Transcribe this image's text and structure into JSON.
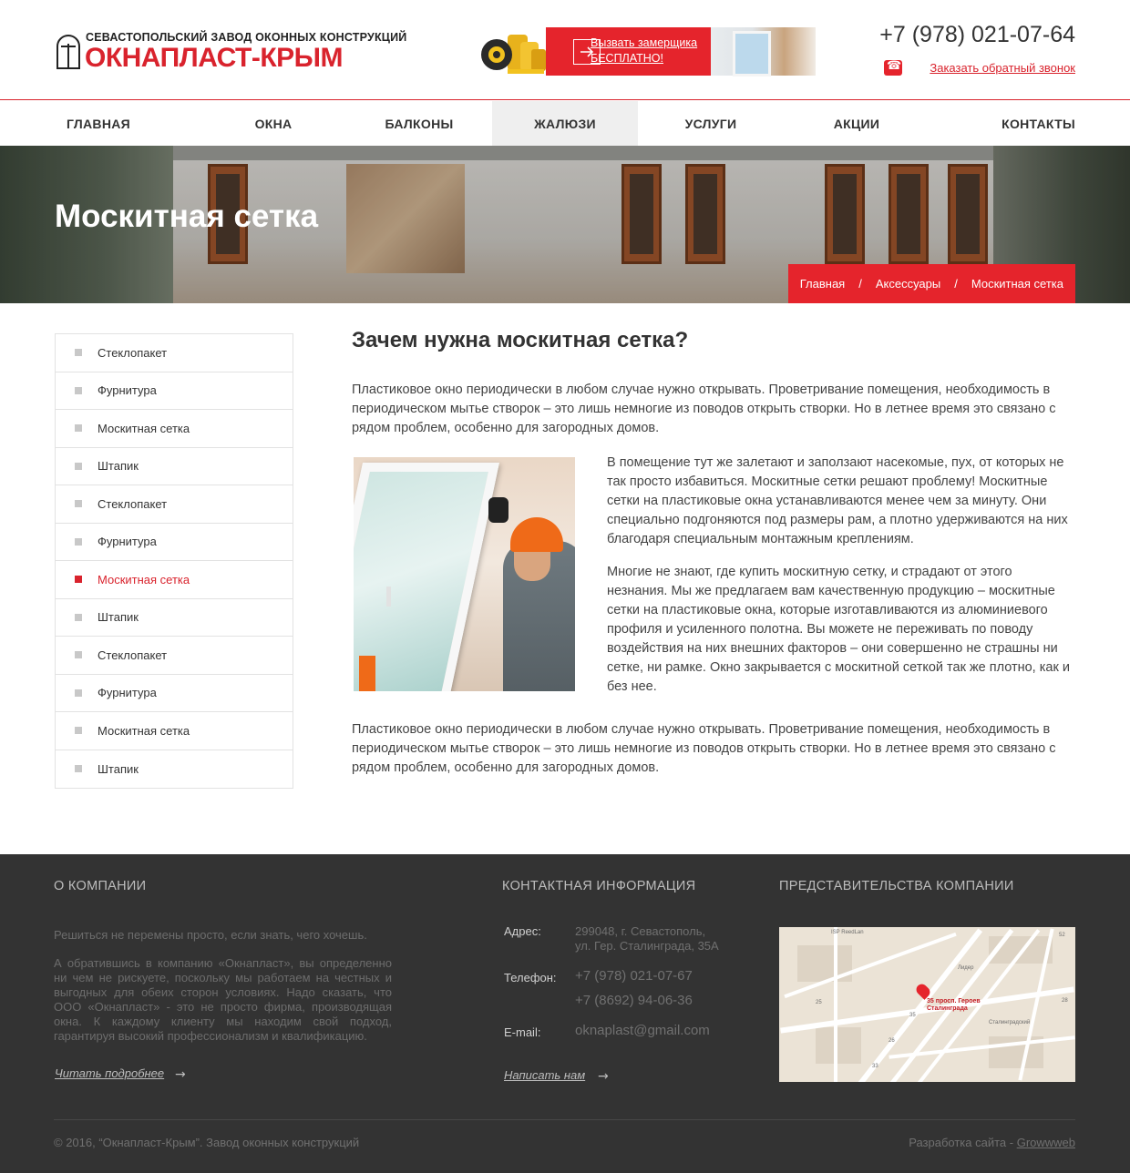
{
  "header": {
    "logo_top": "СЕВАСТОПОЛЬСКИЙ ЗАВОД ОКОННЫХ КОНСТРУКЦИЙ",
    "logo_main": "ОКНАПЛАСТ-КРЫМ",
    "promo_line1": "Вызвать замерщика",
    "promo_line2": "БЕСПЛАТНО!",
    "phone": "+7 (978) 021-07-64",
    "callback": "Заказать обратный звонок"
  },
  "nav": {
    "items": [
      {
        "label": "ГЛАВНАЯ"
      },
      {
        "label": "ОКНА"
      },
      {
        "label": "БАЛКОНЫ"
      },
      {
        "label": "ЖАЛЮЗИ",
        "active": true
      },
      {
        "label": "УСЛУГИ"
      },
      {
        "label": "АКЦИИ"
      },
      {
        "label": "КОНТАКТЫ"
      }
    ]
  },
  "hero": {
    "title": "Москитная сетка",
    "breadcrumb": [
      "Главная",
      "Аксессуары",
      "Москитная сетка"
    ],
    "breadcrumb_sep": "/"
  },
  "sidebar": {
    "items": [
      {
        "label": "Стеклопакет"
      },
      {
        "label": "Фурнитура"
      },
      {
        "label": "Москитная сетка"
      },
      {
        "label": "Штапик"
      },
      {
        "label": "Стеклопакет"
      },
      {
        "label": "Фурнитура"
      },
      {
        "label": "Москитная сетка",
        "active": true
      },
      {
        "label": "Штапик"
      },
      {
        "label": "Стеклопакет"
      },
      {
        "label": "Фурнитура"
      },
      {
        "label": "Москитная сетка"
      },
      {
        "label": "Штапик"
      }
    ]
  },
  "content": {
    "title": "Зачем нужна москитная сетка?",
    "paragraph1": "Пластиковое окно периодически в любом случае нужно открывать. Проветривание помещения, необходимость в периодическом мытье створок – это лишь немногие из поводов открыть створки. Но в летнее время это связано с рядом проблем, особенно для загородных домов.",
    "paragraph2": "В помещение тут же залетают и заползают насекомые, пух, от которых не так просто избавиться. Москитные сетки решают проблему! Москитные сетки на пластиковые окна устанавливаются менее чем за минуту. Они специально подгоняются под размеры рам, а плотно удерживаются на них благодаря специальным монтажным креплениям.",
    "paragraph3": "Многие не знают, где купить москитную сетку, и страдают от этого незнания. Мы же предлагаем вам качественную продукцию – москитные сетки на пластиковые окна, которые изготавливаются из алюминиевого профиля и усиленного полотна. Вы можете не переживать по поводу воздействия на них внешних факторов – они совершенно не страшны ни сетке, ни рамке. Окно закрывается с москитной сеткой так же плотно, как и без нее.",
    "paragraph4": "Пластиковое окно периодически в любом случае нужно открывать. Проветривание помещения, необходимость в периодическом мытье створок – это лишь немногие из поводов открыть створки. Но в летнее время это связано с рядом проблем, особенно для загородных домов."
  },
  "footer": {
    "about_title": "О КОМПАНИИ",
    "about_text1": "Решиться не перемены просто, если знать, чего хочешь.",
    "about_text2": "А обратившись в компанию «Окнапласт», вы определенно ни чем не рискуете, поскольку мы работаем на честных и выгодных для обеих сторон условиях. Надо сказать, что ООО «Окнапласт» - это не просто фирма, производящая окна. К каждому клиенту мы находим свой подход, гарантируя высокий профессионализм и квалификацию.",
    "read_more": "Читать подробнее",
    "contacts_title": "КОНТАКТНАЯ ИНФОРМАЦИЯ",
    "address_label": "Адрес:",
    "address_line1": "299048, г. Севастополь,",
    "address_line2": "ул. Гер. Сталинграда, 35А",
    "phone_label": "Телефон:",
    "phone1": "+7 (978) 021-07-67",
    "phone2": "+7 (8692) 94-06-36",
    "email_label": "E-mail:",
    "email": "oknaplast@gmail.com",
    "write_us": "Написать нам",
    "offices_title": "ПРЕДСТАВИТЕЛЬСТВА КОМПАНИИ",
    "map_label_line1": "35 просп. Героев",
    "map_label_line2": "Сталинграда",
    "map_places": [
      "ISP ReedLan",
      "Лидер",
      "Сталинградский"
    ],
    "map_numbers": [
      "52",
      "35",
      "25",
      "28",
      "33",
      "26"
    ],
    "copyright": "© 2016, “Окнапласт-Крым”. Завод оконных конструкций",
    "dev_text": "Разработка сайта - ",
    "dev_link": "Growwweb"
  },
  "colors": {
    "accent": "#e5242c",
    "footer_bg": "#333333",
    "nav_active_bg": "#efefef"
  }
}
